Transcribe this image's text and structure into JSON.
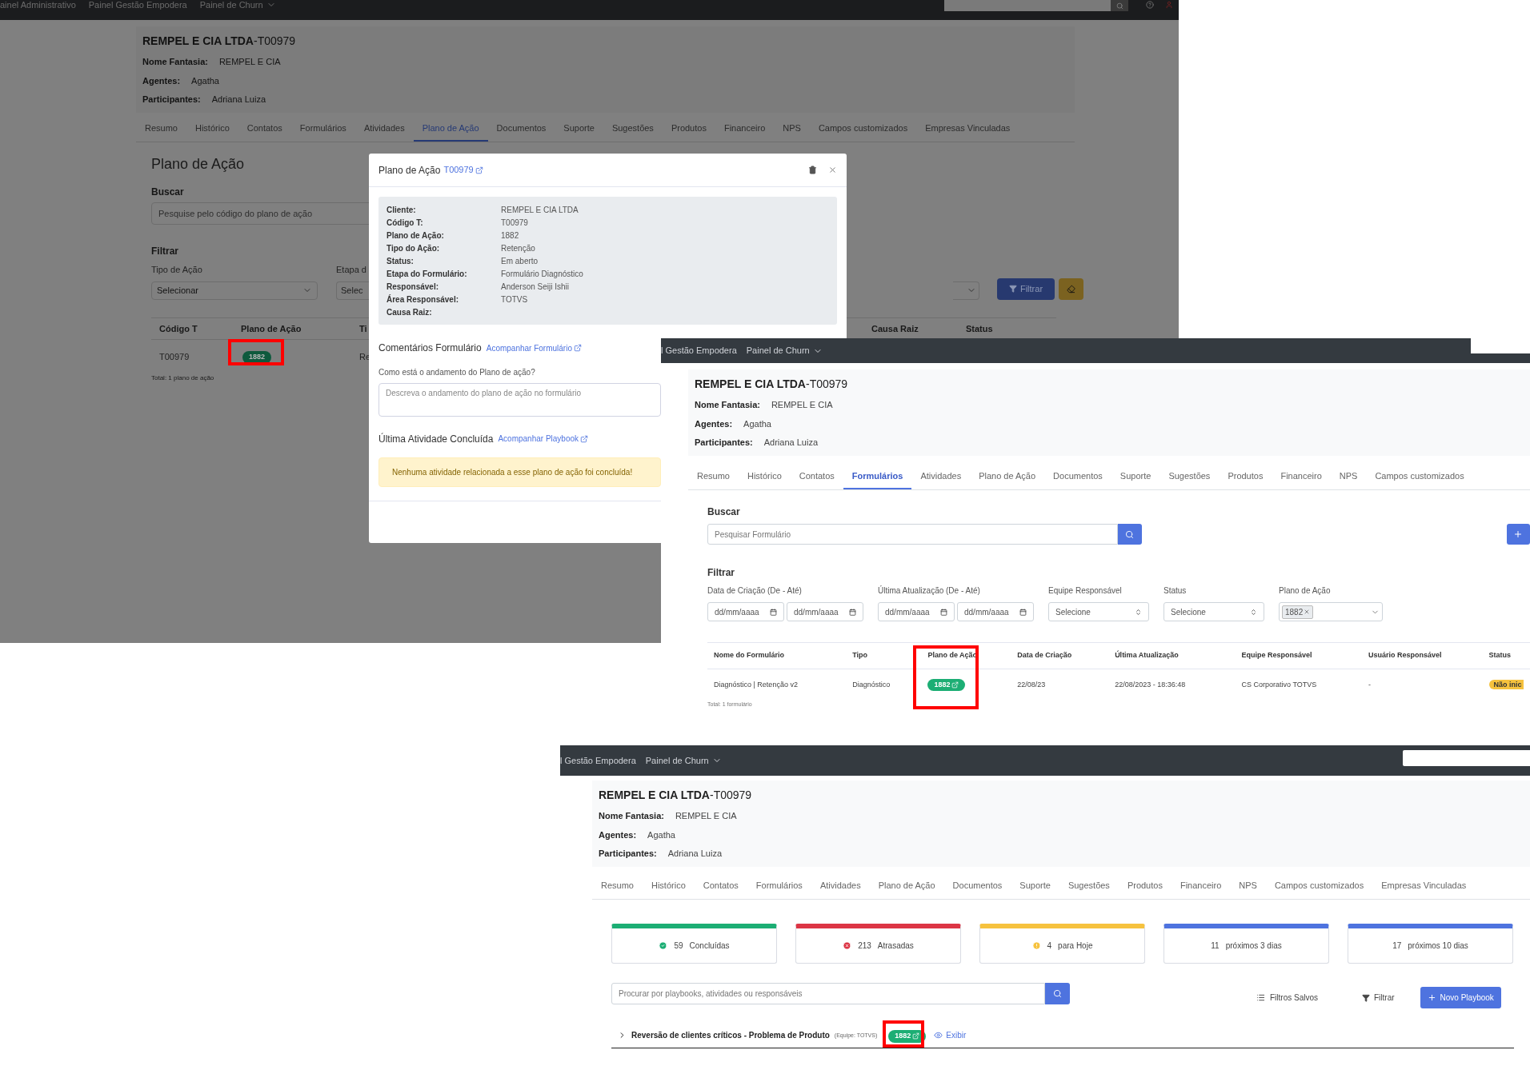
{
  "back_window": {
    "nav": [
      "ainel Administrativo",
      "Painel Gestão Empodera",
      "Painel de Churn"
    ],
    "client": {
      "title": "**REMPEL E CIA LTDA**-T00979",
      "fields": [
        {
          "label": "Nome Fantasia:",
          "value": "REMPEL E CIA"
        },
        {
          "label": "Agentes:",
          "value": "Agatha"
        },
        {
          "label": "Participantes:",
          "value": "Adriana Luiza"
        }
      ]
    },
    "tabs": [
      {
        "label": "Resumo",
        "selected": false
      },
      {
        "label": "Histórico",
        "selected": false
      },
      {
        "label": "Contatos",
        "selected": false
      },
      {
        "label": "Formulários",
        "selected": false
      },
      {
        "label": "Atividades",
        "selected": false
      },
      {
        "label": "Plano de Ação",
        "selected": true
      },
      {
        "label": "Documentos",
        "selected": false
      },
      {
        "label": "Suporte",
        "selected": false
      },
      {
        "label": "Sugestões",
        "selected": false
      },
      {
        "label": "Produtos",
        "selected": false
      },
      {
        "label": "Financeiro",
        "selected": false
      },
      {
        "label": "NPS",
        "selected": false
      },
      {
        "label": "Campos customizados",
        "selected": false
      },
      {
        "label": "Empresas Vinculadas",
        "selected": false
      }
    ],
    "heading": "Plano de Ação",
    "search_label": "Buscar",
    "search_placeholder": "Pesquise pelo código do plano de ação",
    "filter_label": "Filtrar",
    "filters": [
      {
        "label": "Tipo de Ação",
        "value": "Selecionar"
      },
      {
        "label": "Etapa d",
        "value": "Selec"
      }
    ],
    "filter_button": "Filtrar",
    "table": {
      "columns": [
        "Código T",
        "Plano de Ação",
        "Ti",
        "Causa Raiz",
        "Status"
      ],
      "rows": [
        {
          "codigo": "T00979",
          "plano": "1882",
          "tipo": "Re"
        }
      ]
    },
    "total": "Total: 1 plano de ação"
  },
  "modal": {
    "title": "Plano de Ação",
    "code": "T00979",
    "details": [
      {
        "label": "Cliente:",
        "value": "REMPEL E CIA LTDA"
      },
      {
        "label": "Código T:",
        "value": "T00979"
      },
      {
        "label": "Plano de Ação:",
        "value": "1882"
      },
      {
        "label": "Tipo do Ação:",
        "value": "Retenção"
      },
      {
        "label": "Status:",
        "value": "Em aberto"
      },
      {
        "label": "Etapa do Formulário:",
        "value": "Formulário Diagnóstico"
      },
      {
        "label": "Responsável:",
        "value": "Anderson Seiji Ishii"
      },
      {
        "label": "Área Responsável:",
        "value": "TOTVS"
      },
      {
        "label": "Causa Raiz:"
      }
    ],
    "comments_title": "Comentários Formulário",
    "comments_link": "Acompanhar Formulário",
    "question": "Como está o andamento do Plano de ação?",
    "answer_placeholder": "Descreva o andamento do plano de ação no formulário",
    "last_title": "Última Atividade Concluída",
    "last_link": "Acompanhar Playbook",
    "alert": "Nenhuma atividade relacionada a esse plano de ação foi concluída!"
  },
  "forms_window": {
    "nav": [
      "l Gestão Empodera",
      "Painel de Churn"
    ],
    "client": {
      "title": "**REMPEL E CIA LTDA**-T00979",
      "fields": [
        {
          "label": "Nome Fantasia:",
          "value": "REMPEL E CIA"
        },
        {
          "label": "Agentes:",
          "value": "Agatha"
        },
        {
          "label": "Participantes:",
          "value": "Adriana Luiza"
        }
      ]
    },
    "tabs": [
      {
        "label": "Resumo",
        "selected": false
      },
      {
        "label": "Histórico",
        "selected": false
      },
      {
        "label": "Contatos",
        "selected": false
      },
      {
        "label": "Formulários",
        "selected": true
      },
      {
        "label": "Atividades",
        "selected": false
      },
      {
        "label": "Plano de Ação",
        "selected": false
      },
      {
        "label": "Documentos",
        "selected": false
      },
      {
        "label": "Suporte",
        "selected": false
      },
      {
        "label": "Sugestões",
        "selected": false
      },
      {
        "label": "Produtos",
        "selected": false
      },
      {
        "label": "Financeiro",
        "selected": false
      },
      {
        "label": "NPS",
        "selected": false
      },
      {
        "label": "Campos customizados",
        "selected": false
      }
    ],
    "search_label": "Buscar",
    "search_placeholder": "Pesquisar Formulário",
    "filter_label": "Filtrar",
    "filters": [
      {
        "kind": "date_range",
        "label": "Data de Criação (De - Até)",
        "from": "dd/mm/aaaa",
        "to": "dd/mm/aaaa"
      },
      {
        "kind": "date_range",
        "label": "Última Atualização (De - Até)",
        "from": "dd/mm/aaaa",
        "to": "dd/mm/aaaa"
      },
      {
        "kind": "select",
        "label": "Equipe Responsável",
        "value": "Selecione"
      },
      {
        "kind": "select",
        "label": "Status",
        "value": "Selecione"
      },
      {
        "kind": "tags",
        "label": "Plano de Ação",
        "tags": [
          "1882"
        ]
      }
    ],
    "table": {
      "columns": [
        "Nome do Formulário",
        "Tipo",
        "Plano de Ação",
        "Data de Criação",
        "Última Atualização",
        "Equipe Responsável",
        "Usuário Responsável",
        "Status"
      ],
      "rows": [
        {
          "cells": [
            "Diagnóstico | Retenção v2",
            "Diagnóstico",
            "1882",
            "22/08/23",
            "22/08/2023 - 18:36:48",
            "CS Corporativo TOTVS",
            "-",
            "Não inic"
          ]
        }
      ]
    },
    "total": "Total: 1 formulário"
  },
  "playbooks_window": {
    "nav": [
      "l Gestão Empodera",
      "Painel de Churn"
    ],
    "client": {
      "title": "**REMPEL E CIA LTDA**-T00979",
      "fields": [
        {
          "label": "Nome Fantasia:",
          "value": "REMPEL E CIA"
        },
        {
          "label": "Agentes:",
          "value": "Agatha"
        },
        {
          "label": "Participantes:",
          "value": "Adriana Luiza"
        }
      ]
    },
    "tabs": [
      {
        "label": "Resumo",
        "selected": false
      },
      {
        "label": "Histórico",
        "selected": false
      },
      {
        "label": "Contatos",
        "selected": false
      },
      {
        "label": "Formulários",
        "selected": false
      },
      {
        "label": "Atividades",
        "selected": false
      },
      {
        "label": "Plano de Ação",
        "selected": false
      },
      {
        "label": "Documentos",
        "selected": false
      },
      {
        "label": "Suporte",
        "selected": false
      },
      {
        "label": "Sugestões",
        "selected": false
      },
      {
        "label": "Produtos",
        "selected": false
      },
      {
        "label": "Financeiro",
        "selected": false
      },
      {
        "label": "NPS",
        "selected": false
      },
      {
        "label": "Campos customizados",
        "selected": false
      },
      {
        "label": "Empresas Vinculadas",
        "selected": false
      }
    ],
    "stats": [
      {
        "kind": "done",
        "value": "59",
        "label": "Concluídas",
        "color": "#1cae74"
      },
      {
        "kind": "late",
        "value": "213",
        "label": "Atrasadas",
        "color": "#dc3545"
      },
      {
        "kind": "today",
        "value": "4",
        "label": "para Hoje",
        "color": "#f6c23e"
      },
      {
        "kind": "plain",
        "value": "11",
        "label": "próximos 3 dias",
        "color": "#4e73df"
      },
      {
        "kind": "plain",
        "value": "17",
        "label": "próximos 10 dias",
        "color": "#4e73df"
      }
    ],
    "search_placeholder": "Procurar por playbooks, atividades ou responsáveis",
    "saved_filters": "Filtros Salvos",
    "filter_button": "Filtrar",
    "new_button": "Novo Playbook",
    "playbook": {
      "title": "Reversão de clientes críticos - Problema de Produto",
      "team": "(Equipe: TOTVS)",
      "badge": "1882",
      "link": "Exibir"
    }
  }
}
